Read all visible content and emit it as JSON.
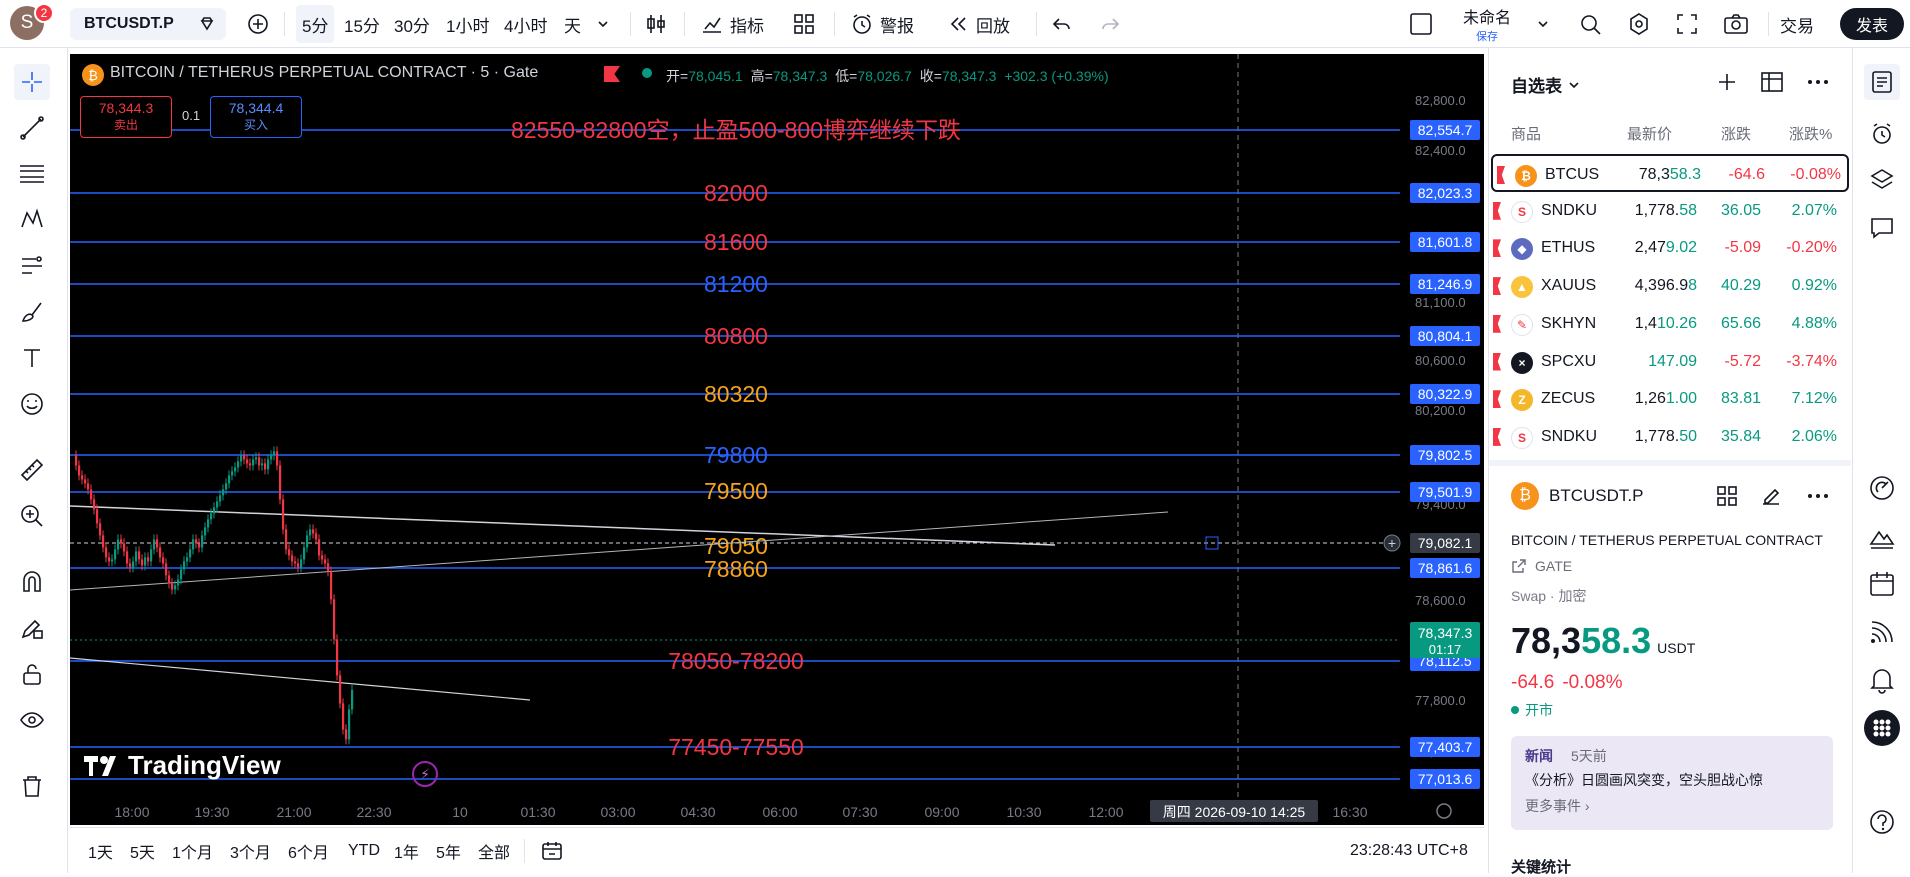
{
  "topbar": {
    "avatar_letter": "S",
    "notif_count": "2",
    "symbol": "BTCUSDT.P",
    "timeframes": [
      "5分",
      "15分",
      "30分",
      "1小时",
      "4小时",
      "天"
    ],
    "indicators": "指标",
    "alert": "警报",
    "replay": "回放",
    "layout_name": "未命名",
    "layout_sub": "保存",
    "trade": "交易",
    "publish": "发表"
  },
  "legend": {
    "title": "BITCOIN / TETHERUS PERPETUAL CONTRACT · 5 · Gate",
    "o_label": "开=",
    "o": "78,045.1",
    "h_label": "高=",
    "h": "78,347.3",
    "l_label": "低=",
    "l": "78,026.7",
    "c_label": "收=",
    "c": "78,347.3",
    "chg": "+302.3 (+0.39%)",
    "sell_price": "78,344.3",
    "sell_label": "卖出",
    "spread": "0.1",
    "buy_price": "78,344.4",
    "buy_label": "买入"
  },
  "annotations": [
    {
      "text": "82550-82800空，止盈500-800博弈继续下跌",
      "color": "#f23645"
    },
    {
      "text": "82000",
      "color": "#f23645"
    },
    {
      "text": "81600",
      "color": "#f23645"
    },
    {
      "text": "81200",
      "color": "#2962ff"
    },
    {
      "text": "80800",
      "color": "#f23645"
    },
    {
      "text": "80320",
      "color": "#f7a21b"
    },
    {
      "text": "79800",
      "color": "#2962ff"
    },
    {
      "text": "79500",
      "color": "#f7a21b"
    },
    {
      "text": "79050",
      "color": "#f7a21b"
    },
    {
      "text": "78860",
      "color": "#f7a21b"
    },
    {
      "text": "78050-78200",
      "color": "#f23645"
    },
    {
      "text": "77450-77550",
      "color": "#f23645"
    }
  ],
  "price_axis": {
    "ticks": [
      "82,800.0",
      "82,400.0",
      "81,100.0",
      "80,600.0",
      "80,200.0",
      "79,400.0",
      "78,600.0",
      "77,800.0",
      "77,400.0"
    ],
    "line_labels": [
      "82,554.7",
      "82,023.3",
      "81,601.8",
      "81,246.9",
      "80,804.1",
      "80,322.9",
      "79,802.5",
      "79,501.9",
      "78,861.6",
      "78,112.5",
      "77,403.7",
      "77,013.6"
    ],
    "crosshair": "79,082.1",
    "last_price": "78,347.3",
    "countdown": "01:17"
  },
  "time_axis": {
    "ticks": [
      "18:00",
      "19:30",
      "21:00",
      "22:30",
      "10",
      "01:30",
      "03:00",
      "04:30",
      "06:00",
      "07:30",
      "09:00",
      "10:30",
      "12:00",
      "16:30"
    ],
    "crosshair_label": "周四 2026-09-10  14:25"
  },
  "watermark": "TradingView",
  "bottombar": {
    "ranges": [
      "1天",
      "5天",
      "1个月",
      "3个月",
      "6个月",
      "YTD",
      "1年",
      "5年",
      "全部"
    ],
    "clock": "23:28:43 UTC+8"
  },
  "watchlist": {
    "title": "自选表",
    "columns": [
      "商品",
      "最新价",
      "涨跌",
      "涨跌%"
    ],
    "rows": [
      {
        "sym": "BTCUS",
        "price_a": "78,3",
        "price_b": "58.3",
        "chg": "-64.6",
        "pct": "-0.08%",
        "dir": "dn",
        "coin_color": "#f7931a",
        "coin": "₿"
      },
      {
        "sym": "SNDKU",
        "price_a": "1,778.",
        "price_b": "58",
        "chg": "36.05",
        "pct": "2.07%",
        "dir": "up",
        "coin_color": "#ffffff",
        "coin": "S"
      },
      {
        "sym": "ETHUS",
        "price_a": "2,47",
        "price_b": "9.02",
        "chg": "-5.09",
        "pct": "-0.20%",
        "dir": "dn",
        "coin_color": "#5c6bc0",
        "coin": "◆"
      },
      {
        "sym": "XAUUS",
        "price_a": "4,396.9",
        "price_b": "8",
        "chg": "40.29",
        "pct": "0.92%",
        "dir": "up",
        "coin_color": "#f9c33c",
        "coin": "▲"
      },
      {
        "sym": "SKHYN",
        "price_a": "1,4",
        "price_b": "10.26",
        "chg": "65.66",
        "pct": "4.88%",
        "dir": "up",
        "coin_color": "#ffffff",
        "coin": "✎"
      },
      {
        "sym": "SPCXU",
        "price_a": "",
        "price_b": "147.09",
        "chg": "-5.72",
        "pct": "-3.74%",
        "dir": "dn",
        "coin_color": "#131722",
        "coin": "×"
      },
      {
        "sym": "ZECUS",
        "price_a": "1,26",
        "price_b": "1.00",
        "chg": "83.81",
        "pct": "7.12%",
        "dir": "up",
        "coin_color": "#f4b728",
        "coin": "Z"
      },
      {
        "sym": "SNDKU",
        "price_a": "1,778.",
        "price_b": "50",
        "chg": "35.84",
        "pct": "2.06%",
        "dir": "up",
        "coin_color": "#ffffff",
        "coin": "S"
      }
    ]
  },
  "detail": {
    "symbol": "BTCUSDT.P",
    "name": "BITCOIN / TETHERUS PERPETUAL CONTRACT",
    "exchange": "GATE",
    "category": "Swap · 加密",
    "price_a": "78,3",
    "price_b": "58.3",
    "currency": "USDT",
    "chg": "-64.6",
    "pct": "-0.08%",
    "status": "开市",
    "news_label": "新闻",
    "news_time": "5天前",
    "news_text": "《分析》日圆画风突变，空头胆战心惊",
    "more_events": "更多事件 ›",
    "key_stats": "关键统计"
  },
  "colors": {
    "bg_chart": "#000000",
    "up": "#089981",
    "down": "#f23645",
    "line": "#2962ff"
  }
}
